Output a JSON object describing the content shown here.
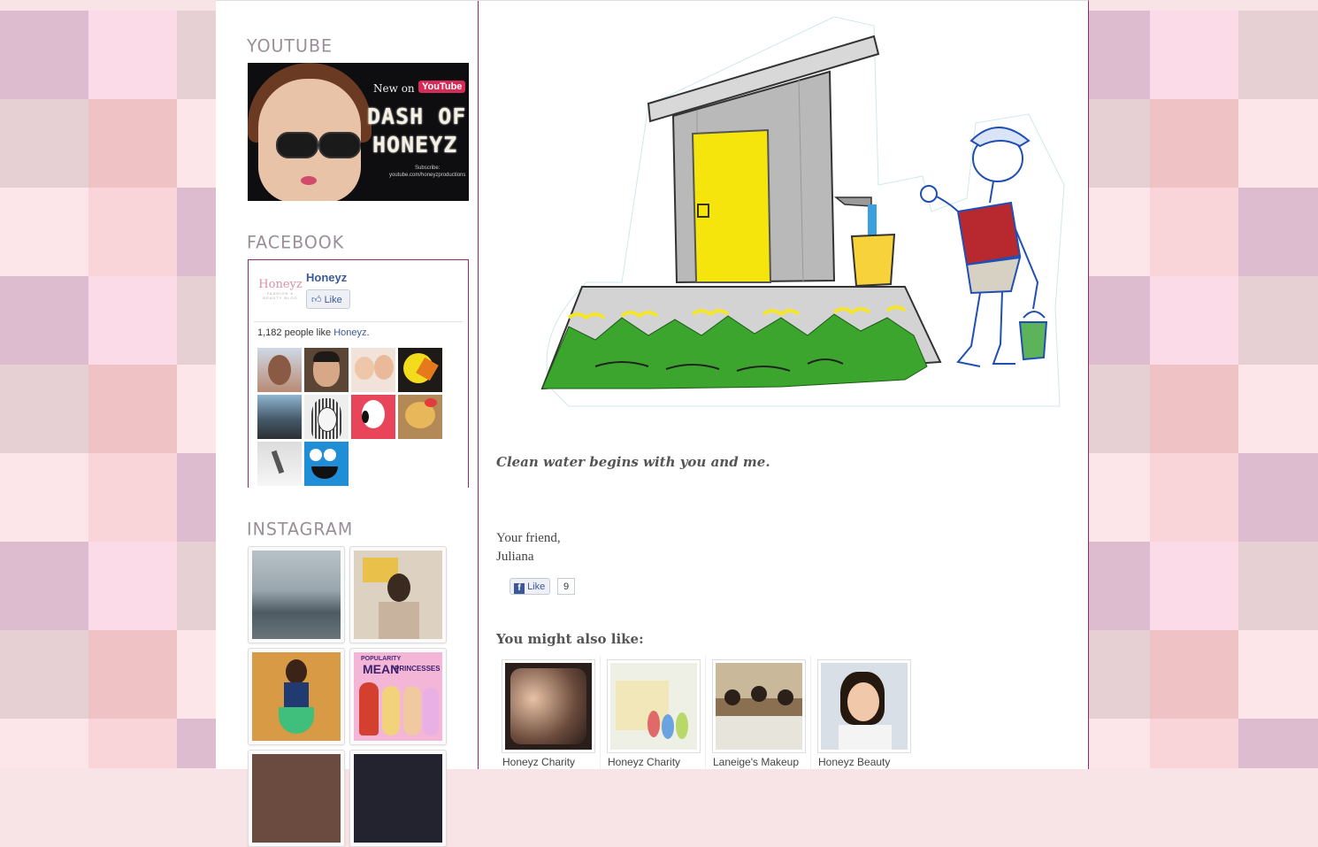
{
  "sidebar": {
    "youtube": {
      "title": "YOUTUBE",
      "banner": {
        "new_on": "New on",
        "youtube_logo": "YouTube",
        "line1": "DASH OF",
        "line2": "HONEYZ",
        "subscribe": "Subscribe:",
        "channel_url": "youtube.com/honeyzproductions"
      }
    },
    "facebook": {
      "title": "FACEBOOK",
      "page_logo_text": "Honeyz",
      "page_logo_tagline": "FASHION & BEAUTY BLOG",
      "page_name": "Honeyz",
      "like_label": "Like",
      "count_text": "1,182 people like ",
      "count_link": "Honeyz",
      "count_suffix": "."
    },
    "instagram": {
      "title": "INSTAGRAM",
      "mean_text1": "POPULARITY",
      "mean_text2": "MEAN",
      "mean_text3": "PRINCESSES"
    }
  },
  "main": {
    "caption": "Clean water begins with you and me.",
    "signoff_line1": "Your friend,",
    "signoff_line2": "Juliana",
    "like_label": "Like",
    "like_count": "9",
    "related_title": "You might also like:",
    "related": [
      {
        "label": "Honeyz Charity"
      },
      {
        "label": "Honeyz Charity"
      },
      {
        "label": "Laneige's Makeup"
      },
      {
        "label": "Honeyz Beauty"
      }
    ]
  },
  "colors": {
    "accent_border": "#8b2b6e",
    "fb_blue": "#3b5998",
    "checker": [
      "#dcbcce",
      "#f9d4d8",
      "#fde6ea",
      "#efc3c6",
      "#e6d0d4",
      "#fbdbe8"
    ]
  }
}
